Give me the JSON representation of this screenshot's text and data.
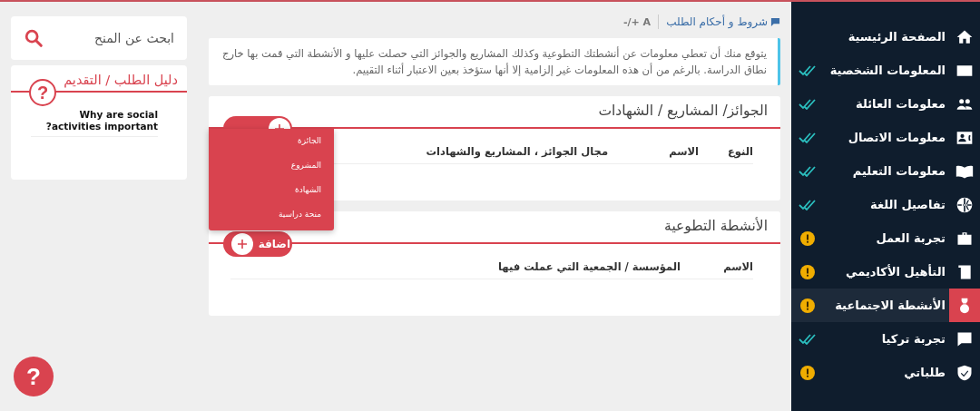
{
  "sidebar": {
    "items": [
      {
        "label": "الصفحة الرئيسية",
        "selected": false
      },
      {
        "label": "المعلومات الشخصية",
        "complete": true,
        "selected": false
      },
      {
        "label": "معلومات العائلة",
        "complete": true,
        "selected": false
      },
      {
        "label": "معلومات الاتصال",
        "complete": true,
        "selected": false
      },
      {
        "label": "معلومات التعليم",
        "complete": true,
        "selected": false
      },
      {
        "label": "تفاصيل اللغة",
        "complete": true,
        "selected": false
      },
      {
        "label": "تجربة العمل",
        "complete": false,
        "selected": false
      },
      {
        "label": "التأهيل الأكاديمي",
        "complete": false,
        "selected": false
      },
      {
        "label": "الأنشطة الاجتماعية",
        "complete": false,
        "selected": true
      },
      {
        "label": "تجربة تركيا",
        "complete": true,
        "selected": false
      },
      {
        "label": "طلباتي",
        "complete": false,
        "selected": false
      }
    ]
  },
  "toolbar": {
    "terms_link": "شروط و أحكام الطلب",
    "font_size": "-/+ A"
  },
  "info": "يتوقع منك أن تعطي معلومات عن أنشطتك التطوعية وكذلك المشاريع والجوائز التي حصلت عليها و الأنشطة التي قمت بها خارج نطاق الدراسة. بالرغم من أن هذه المعلومات غير إلزامية إلا أنها ستؤخذ بعين الاعتبار أثناء التقييم.",
  "sections": [
    {
      "title": "الجوائز/ المشاريع / الشهادات",
      "columns": [
        "النوع",
        "الاسم",
        "مجال الجوائز ، المشاريع والشهادات"
      ]
    },
    {
      "title": "الأنشطة التطوعية",
      "add_button": "اضافة",
      "columns": [
        "الاسم",
        "المؤسسة / الجمعية التي عملت فيها"
      ]
    }
  ],
  "add_menu": {
    "items": [
      "الجائزة",
      "المشروع",
      "الشهادة",
      "منحة دراسية"
    ]
  },
  "search": {
    "placeholder": "ابحث عن المنح"
  },
  "guide": {
    "title": "دليل الطلب / التقديم",
    "help_mark": "?",
    "questions": [
      "Why are social activities important?"
    ]
  },
  "help_button": "?"
}
